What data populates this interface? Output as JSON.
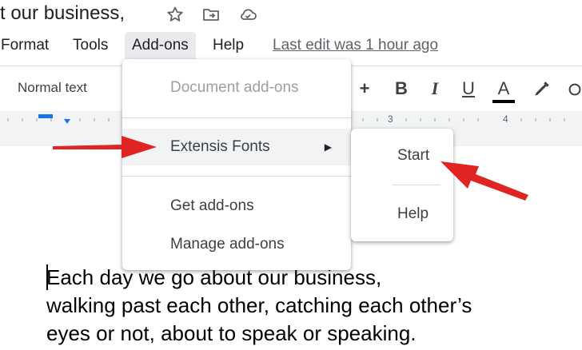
{
  "doc": {
    "title": "t our business,",
    "icons": [
      "star-icon",
      "move-to-folder-icon",
      "cloud-saved-icon"
    ]
  },
  "menubar": {
    "items": [
      {
        "label": "Format"
      },
      {
        "label": "Tools"
      },
      {
        "label": "Add-ons",
        "active": true
      },
      {
        "label": "Help"
      }
    ],
    "last_edit": "Last edit was 1 hour ago"
  },
  "toolbar": {
    "style_select": "Normal text",
    "plus": "+",
    "bold": "B",
    "italic": "I",
    "underline": "U",
    "text_color": "A"
  },
  "ruler": {
    "marks": [
      "3",
      "4"
    ]
  },
  "addons_menu": {
    "items": [
      {
        "label": "Document add-ons",
        "disabled": true
      },
      {
        "label": "Extensis Fonts",
        "has_submenu": true
      },
      {
        "label": "Get add-ons"
      },
      {
        "label": "Manage add-ons"
      }
    ]
  },
  "submenu": {
    "items": [
      {
        "label": "Start"
      },
      {
        "label": "Help"
      }
    ]
  },
  "body": {
    "lines": [
      "Each day we go about our business,",
      "walking past each other, catching each other’s",
      "eyes or not, about to speak or speaking."
    ]
  },
  "colors": {
    "annotation_arrow": "#e02424",
    "menu_hover": "#f1f3f4",
    "disabled_text": "#9aa0a6"
  }
}
